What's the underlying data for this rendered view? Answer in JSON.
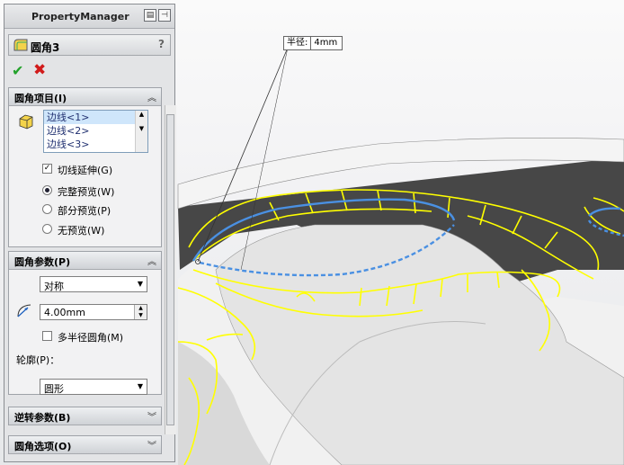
{
  "property_manager": {
    "title": "PropertyManager",
    "feature_name": "圆角3",
    "help_icon": "?",
    "ok_icon": "✔",
    "cancel_icon": "✖"
  },
  "fillet_items": {
    "header": "圆角项目(I)",
    "edges": [
      "边线<1>",
      "边线<2>",
      "边线<3>"
    ],
    "tangent_propagation": "切线延伸(G)",
    "preview_full": "完整预览(W)",
    "preview_partial": "部分预览(P)",
    "preview_none": "无预览(W)"
  },
  "fillet_params": {
    "header": "圆角参数(P)",
    "symmetric": "对称",
    "radius": "4.00mm",
    "multi_radius": "多半径圆角(M)",
    "profile_label": "轮廓(P)：",
    "profile": "圆形"
  },
  "setback": {
    "header": "逆转参数(B)"
  },
  "options": {
    "header": "圆角选项(O)"
  },
  "callout": {
    "label": "半径:",
    "value": "4mm"
  },
  "colors": {
    "highlight_yellow": "#ffff00",
    "selection_blue": "#4a90e2",
    "dark_face": "#4a4a4a"
  }
}
